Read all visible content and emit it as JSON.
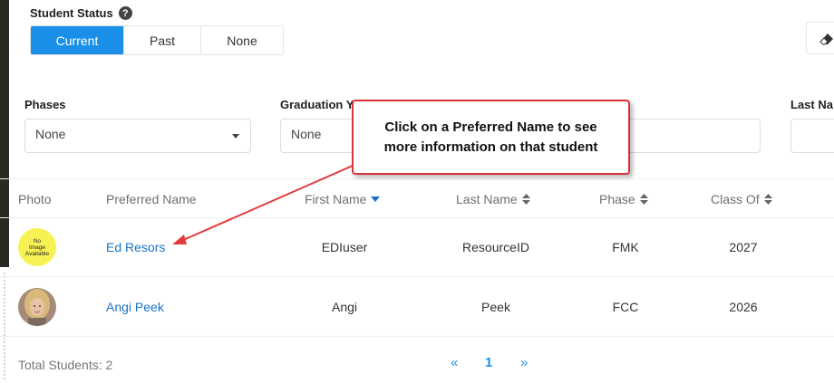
{
  "status": {
    "label": "Student Status",
    "help_icon": "?",
    "options": [
      "Current",
      "Past",
      "None"
    ],
    "selected": "Current"
  },
  "toolbar": {
    "clear_icon": "eraser-icon"
  },
  "filters": {
    "phases": {
      "label": "Phases",
      "value": "None"
    },
    "graduation_year": {
      "label": "Graduation Y",
      "value": "None"
    },
    "last_name": {
      "label": "Last Na"
    }
  },
  "table": {
    "headers": {
      "photo": "Photo",
      "preferred_name": "Preferred Name",
      "first_name": "First Name",
      "last_name": "Last Name",
      "phase": "Phase",
      "class_of": "Class Of"
    },
    "rows": [
      {
        "photo_text": [
          "No",
          "Image",
          "Available"
        ],
        "preferred_name": "Ed Resors",
        "first_name": "EDIuser",
        "last_name": "ResourceID",
        "phase": "FMK",
        "class_of": "2027"
      },
      {
        "photo_text": [],
        "preferred_name": "Angi Peek",
        "first_name": "Angi",
        "last_name": "Peek",
        "phase": "FCC",
        "class_of": "2026"
      }
    ]
  },
  "footer": {
    "total": "Total Students: 2",
    "prev": "«",
    "page": "1",
    "next": "»"
  },
  "callout": {
    "line1": "Click on a Preferred Name to see",
    "line2": "more information on that student"
  },
  "colors": {
    "accent": "#1a8fe8",
    "link": "#1a73c8",
    "callout_border": "#d9333a"
  }
}
